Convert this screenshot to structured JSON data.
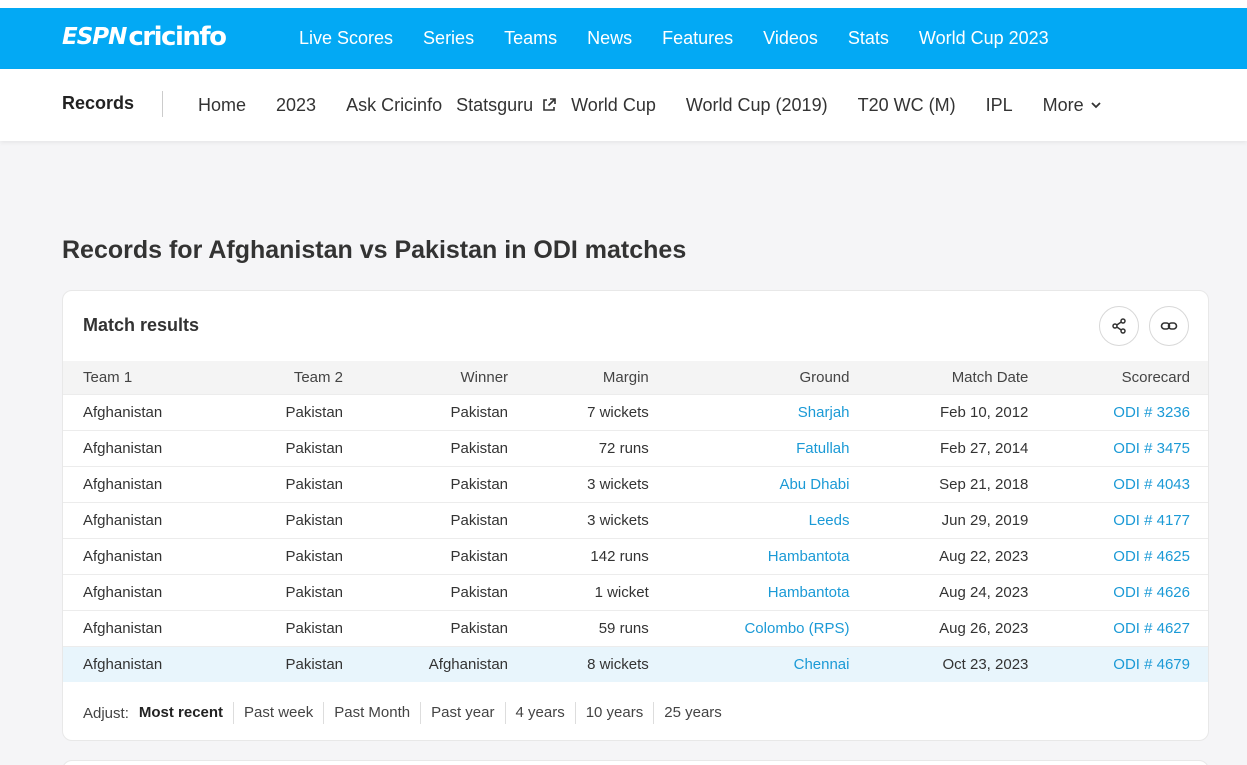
{
  "logo": {
    "espn": "ESPN",
    "cricinfo": "cricinfo"
  },
  "topnav": {
    "items": [
      "Live Scores",
      "Series",
      "Teams",
      "News",
      "Features",
      "Videos",
      "Stats",
      "World Cup 2023"
    ]
  },
  "subnav": {
    "title": "Records",
    "items": [
      "Home",
      "2023",
      "Ask Cricinfo",
      "Statsguru",
      "World Cup",
      "World Cup (2019)",
      "T20 WC (M)",
      "IPL",
      "More"
    ]
  },
  "page": {
    "title": "Records for Afghanistan vs Pakistan in ODI matches"
  },
  "card": {
    "title": "Match results",
    "columns": [
      "Team 1",
      "Team 2",
      "Winner",
      "Margin",
      "Ground",
      "Match Date",
      "Scorecard"
    ],
    "rows": [
      [
        "Afghanistan",
        "Pakistan",
        "Pakistan",
        "7 wickets",
        "Sharjah",
        "Feb 10, 2012",
        "ODI # 3236"
      ],
      [
        "Afghanistan",
        "Pakistan",
        "Pakistan",
        "72 runs",
        "Fatullah",
        "Feb 27, 2014",
        "ODI # 3475"
      ],
      [
        "Afghanistan",
        "Pakistan",
        "Pakistan",
        "3 wickets",
        "Abu Dhabi",
        "Sep 21, 2018",
        "ODI # 4043"
      ],
      [
        "Afghanistan",
        "Pakistan",
        "Pakistan",
        "3 wickets",
        "Leeds",
        "Jun 29, 2019",
        "ODI # 4177"
      ],
      [
        "Afghanistan",
        "Pakistan",
        "Pakistan",
        "142 runs",
        "Hambantota",
        "Aug 22, 2023",
        "ODI # 4625"
      ],
      [
        "Afghanistan",
        "Pakistan",
        "Pakistan",
        "1 wicket",
        "Hambantota",
        "Aug 24, 2023",
        "ODI # 4626"
      ],
      [
        "Afghanistan",
        "Pakistan",
        "Pakistan",
        "59 runs",
        "Colombo (RPS)",
        "Aug 26, 2023",
        "ODI # 4627"
      ],
      [
        "Afghanistan",
        "Pakistan",
        "Afghanistan",
        "8 wickets",
        "Chennai",
        "Oct 23, 2023",
        "ODI # 4679"
      ]
    ],
    "adjust": {
      "label": "Adjust:",
      "options": [
        "Most recent",
        "Past week",
        "Past Month",
        "Past year",
        "4 years",
        "10 years",
        "25 years"
      ]
    }
  },
  "colors": {
    "brand": "#03a9f4",
    "link": "#1b9ad6",
    "highlight_row": "#e8f5fc"
  },
  "icons": {
    "external": "external-link-icon",
    "more": "chevron-down-icon",
    "share": "share-icon",
    "link": "link-icon"
  }
}
